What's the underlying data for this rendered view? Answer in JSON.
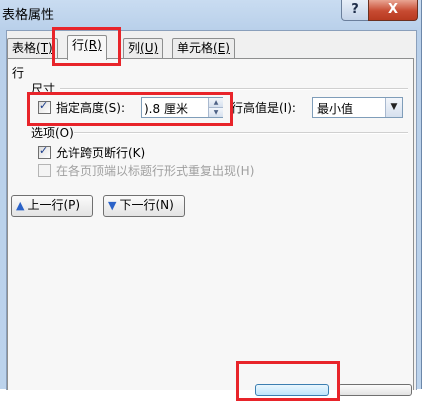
{
  "window": {
    "title": "表格属性",
    "help_label": "?",
    "close_label": "X"
  },
  "tabs": [
    {
      "label": "表格",
      "key": "(T)"
    },
    {
      "label": "行",
      "key": "(R)"
    },
    {
      "label": "列",
      "key": "(U)"
    },
    {
      "label": "单元格",
      "key": "(E)"
    }
  ],
  "row_panel": {
    "section_title": "行",
    "size_group": "尺寸",
    "specify_height": {
      "label": "指定高度(S):",
      "checked": true
    },
    "height_input": {
      "value": ").8 厘米"
    },
    "height_rule": {
      "label": "行高值是(I):",
      "selected": "最小值"
    },
    "options_group": "选项(O)",
    "allow_break": {
      "label": "允许跨页断行(K)",
      "checked": true
    },
    "repeat_header": {
      "label": "在各页顶端以标题行形式重复出现(H)",
      "checked": false,
      "disabled": true
    },
    "prev_row_button": "上一行(P)",
    "next_row_button": "下一行(N)"
  },
  "icons": {
    "up_arrow": "up-arrow-icon",
    "down_arrow": "down-arrow-icon",
    "dropdown": "chevron-down-icon",
    "checkmark": "check-icon"
  },
  "colors": {
    "highlight": "#e8242a",
    "titlebar": "#c9dcf1",
    "close": "#c74b32"
  }
}
